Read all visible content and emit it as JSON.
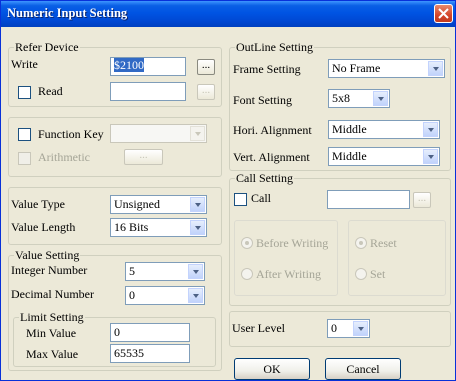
{
  "window": {
    "title": "Numeric Input Setting"
  },
  "refer_device": {
    "group_label": "Refer Device",
    "write_label": "Write",
    "write_value": "$2100",
    "read_label": "Read",
    "read_value": "",
    "browse_label": "..."
  },
  "function_key": {
    "label": "Function Key",
    "value": "",
    "arithmetic_label": "Arithmetic",
    "arith_btn": "..."
  },
  "value_type": {
    "label": "Value Type",
    "value": "Unsigned"
  },
  "value_length": {
    "label": "Value Length",
    "value": "16 Bits"
  },
  "value_setting": {
    "group_label": "Value Setting",
    "integer_label": "Integer Number",
    "integer_value": "5",
    "decimal_label": "Decimal Number",
    "decimal_value": "0"
  },
  "limit_setting": {
    "group_label": "Limit Setting",
    "min_label": "Min Value",
    "min_value": "0",
    "max_label": "Max Value",
    "max_value": "65535"
  },
  "outline": {
    "group_label": "OutLine Setting",
    "frame_label": "Frame Setting",
    "frame_value": "No Frame",
    "font_label": "Font Setting",
    "font_value": "5x8",
    "hori_label": "Hori. Alignment",
    "hori_value": "Middle",
    "vert_label": "Vert. Alignment",
    "vert_value": "Middle"
  },
  "call_setting": {
    "group_label": "Call Setting",
    "call_label": "Call",
    "call_value": "",
    "browse_label": "...",
    "before_writing": "Before Writing",
    "after_writing": "After Writing",
    "reset": "Reset",
    "set": "Set"
  },
  "user_level": {
    "label": "User Level",
    "value": "0"
  },
  "buttons": {
    "ok": "OK",
    "cancel": "Cancel"
  },
  "colors": {
    "titlebar": "#0054e3",
    "dialog_bg": "#ece9d8",
    "close": "#d4452a",
    "field_border": "#7f9db9",
    "selection": "#316ac5"
  }
}
